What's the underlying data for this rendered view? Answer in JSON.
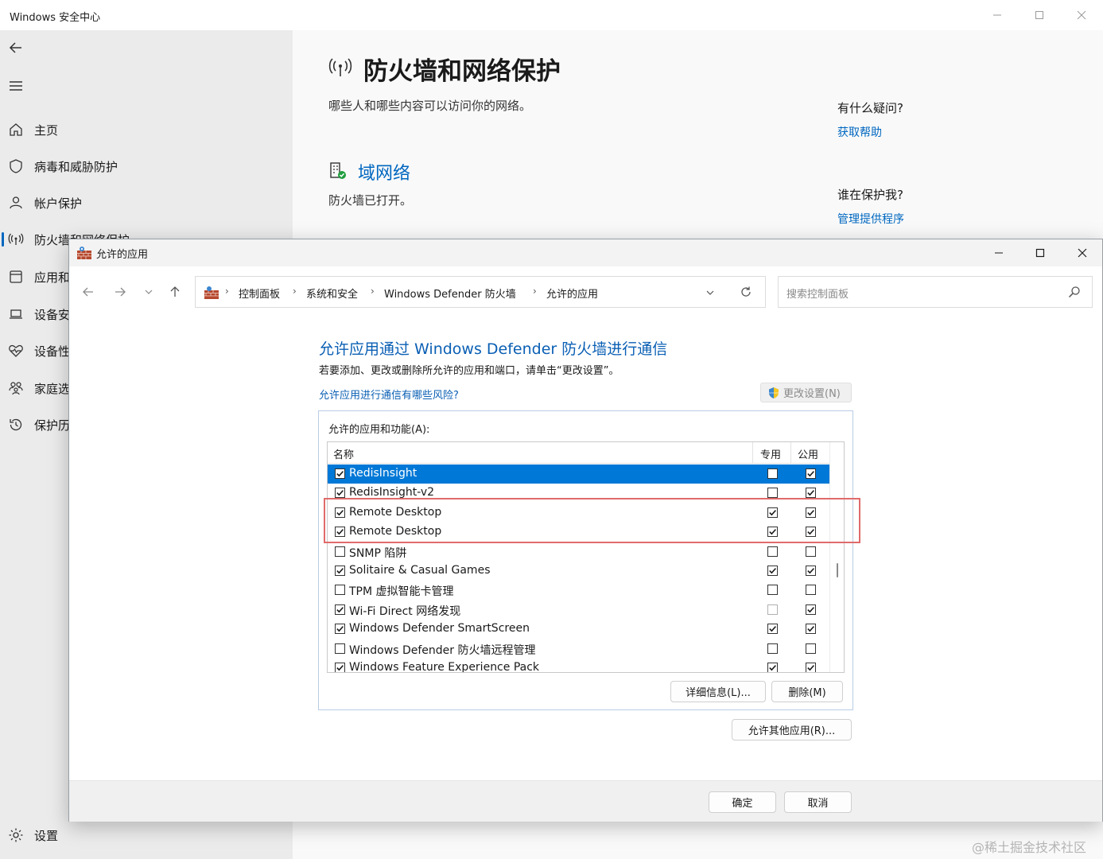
{
  "security_window": {
    "title": "Windows 安全中心",
    "nav_items": [
      {
        "label": "主页",
        "icon": "home-icon"
      },
      {
        "label": "病毒和威胁防护",
        "icon": "shield-icon"
      },
      {
        "label": "帐户保护",
        "icon": "person-icon"
      },
      {
        "label": "防火墙和网络保护",
        "icon": "antenna-icon"
      },
      {
        "label": "应用和",
        "icon": "app-window-icon"
      },
      {
        "label": "设备安",
        "icon": "laptop-icon"
      },
      {
        "label": "设备性",
        "icon": "heart-pulse-icon"
      },
      {
        "label": "家庭选",
        "icon": "family-icon"
      },
      {
        "label": "保护历",
        "icon": "history-icon"
      }
    ],
    "settings_label": "设置",
    "page_title": "防火墙和网络保护",
    "page_desc": "哪些人和哪些内容可以访问你的网络。",
    "domain_network": "域网络",
    "domain_status": "防火墙已打开。",
    "help_question": "有什么疑问?",
    "help_link": "获取帮助",
    "who_question": "谁在保护我?",
    "who_link": "管理提供程序"
  },
  "dialog": {
    "title": "允许的应用",
    "breadcrumbs": [
      "控制面板",
      "系统和安全",
      "Windows Defender 防火墙",
      "允许的应用"
    ],
    "search_placeholder": "搜索控制面板",
    "heading": "允许应用通过 Windows Defender 防火墙进行通信",
    "subtext": "若要添加、更改或删除所允许的应用和端口，请单击“更改设置”。",
    "risk_link": "允许应用进行通信有哪些风险?",
    "change_settings": "更改设置(N)",
    "group_label": "允许的应用和功能(A):",
    "columns": {
      "name": "名称",
      "private": "专用",
      "public": "公用"
    },
    "rows": [
      {
        "name": "RedisInsight",
        "enabled": true,
        "private": false,
        "public": true,
        "selected": true
      },
      {
        "name": "RedisInsight-v2",
        "enabled": true,
        "private": false,
        "public": true
      },
      {
        "name": "Remote Desktop",
        "enabled": true,
        "private": true,
        "public": true
      },
      {
        "name": "Remote Desktop",
        "enabled": true,
        "private": true,
        "public": true
      },
      {
        "name": "SNMP 陷阱",
        "enabled": false,
        "private": false,
        "public": false
      },
      {
        "name": "Solitaire & Casual Games",
        "enabled": true,
        "private": true,
        "public": true
      },
      {
        "name": "TPM 虚拟智能卡管理",
        "enabled": false,
        "private": false,
        "public": false
      },
      {
        "name": "Wi-Fi Direct 网络发现",
        "enabled": true,
        "private": false,
        "public": true,
        "private_dim": true
      },
      {
        "name": "Windows Defender SmartScreen",
        "enabled": true,
        "private": true,
        "public": true
      },
      {
        "name": "Windows Defender 防火墙远程管理",
        "enabled": false,
        "private": false,
        "public": false
      },
      {
        "name": "Windows Feature Experience Pack",
        "enabled": true,
        "private": true,
        "public": true
      }
    ],
    "details_button": "详细信息(L)...",
    "delete_button": "删除(M)",
    "allow_other_button": "允许其他应用(R)...",
    "ok_button": "确定",
    "cancel_button": "取消"
  },
  "watermark": "@稀土掘金技术社区",
  "colors": {
    "accent": "#0067c0",
    "link": "#0a5fb4",
    "selection": "#0078d7",
    "highlight": "#e06a6a"
  }
}
